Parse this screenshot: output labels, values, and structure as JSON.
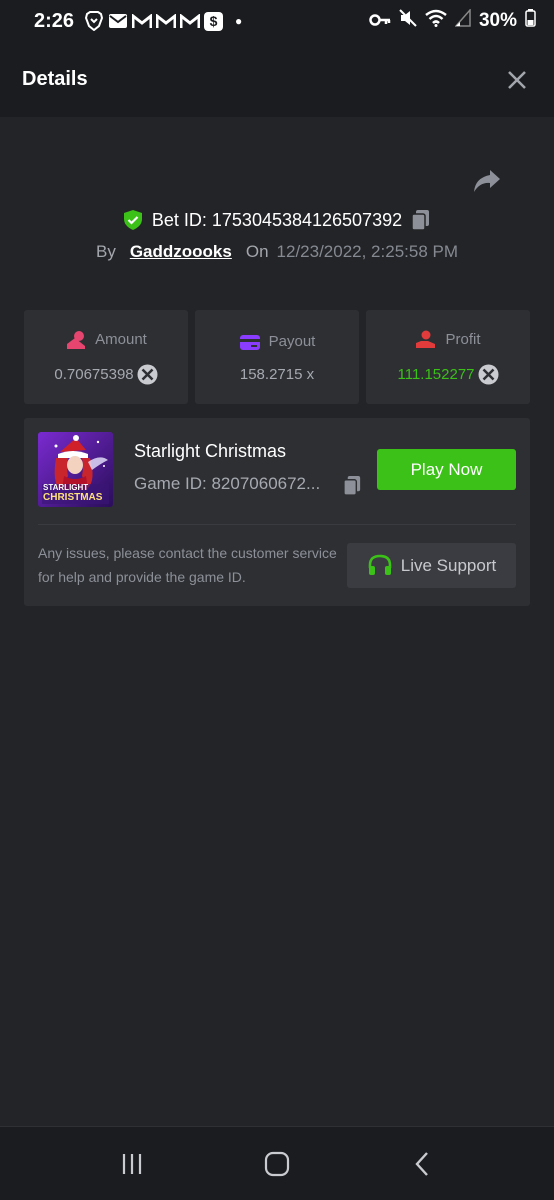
{
  "status_bar": {
    "time": "2:26",
    "battery": "30%",
    "notification_icons": [
      "brave-icon",
      "mail-icon",
      "gmail-icon",
      "gmail-icon",
      "gmail-icon",
      "cash-app-icon"
    ],
    "system_icons": [
      "key-icon",
      "mute-icon",
      "wifi-icon",
      "signal-icon",
      "battery-icon"
    ]
  },
  "header": {
    "title": "Details"
  },
  "bet": {
    "bet_id": "Bet ID: 1753045384126507392",
    "by_label": "By",
    "username": "Gaddzoooks",
    "on_label": "On",
    "date": "12/23/2022, 2:25:58 PM"
  },
  "stats": {
    "amount": {
      "label": "Amount",
      "value": "0.70675398"
    },
    "payout": {
      "label": "Payout",
      "value": "158.2715 x"
    },
    "profit": {
      "label": "Profit",
      "value": "111.152277"
    }
  },
  "game": {
    "name": "Starlight Christmas",
    "game_id": "Game ID: 8207060672...",
    "play_label": "Play Now",
    "thumb_text_1": "STARLIGHT",
    "thumb_text_2": "CHRISTMAS",
    "note": "Any issues, please contact the customer service for help and provide the game ID.",
    "support_label": "Live Support"
  },
  "colors": {
    "background": "#232427",
    "card": "#2d2f33",
    "header": "#1b1c1f",
    "green": "#3bc117",
    "amount_icon": "#e5456f",
    "payout_icon": "#8b3dff",
    "profit_icon": "#e23b3b"
  }
}
